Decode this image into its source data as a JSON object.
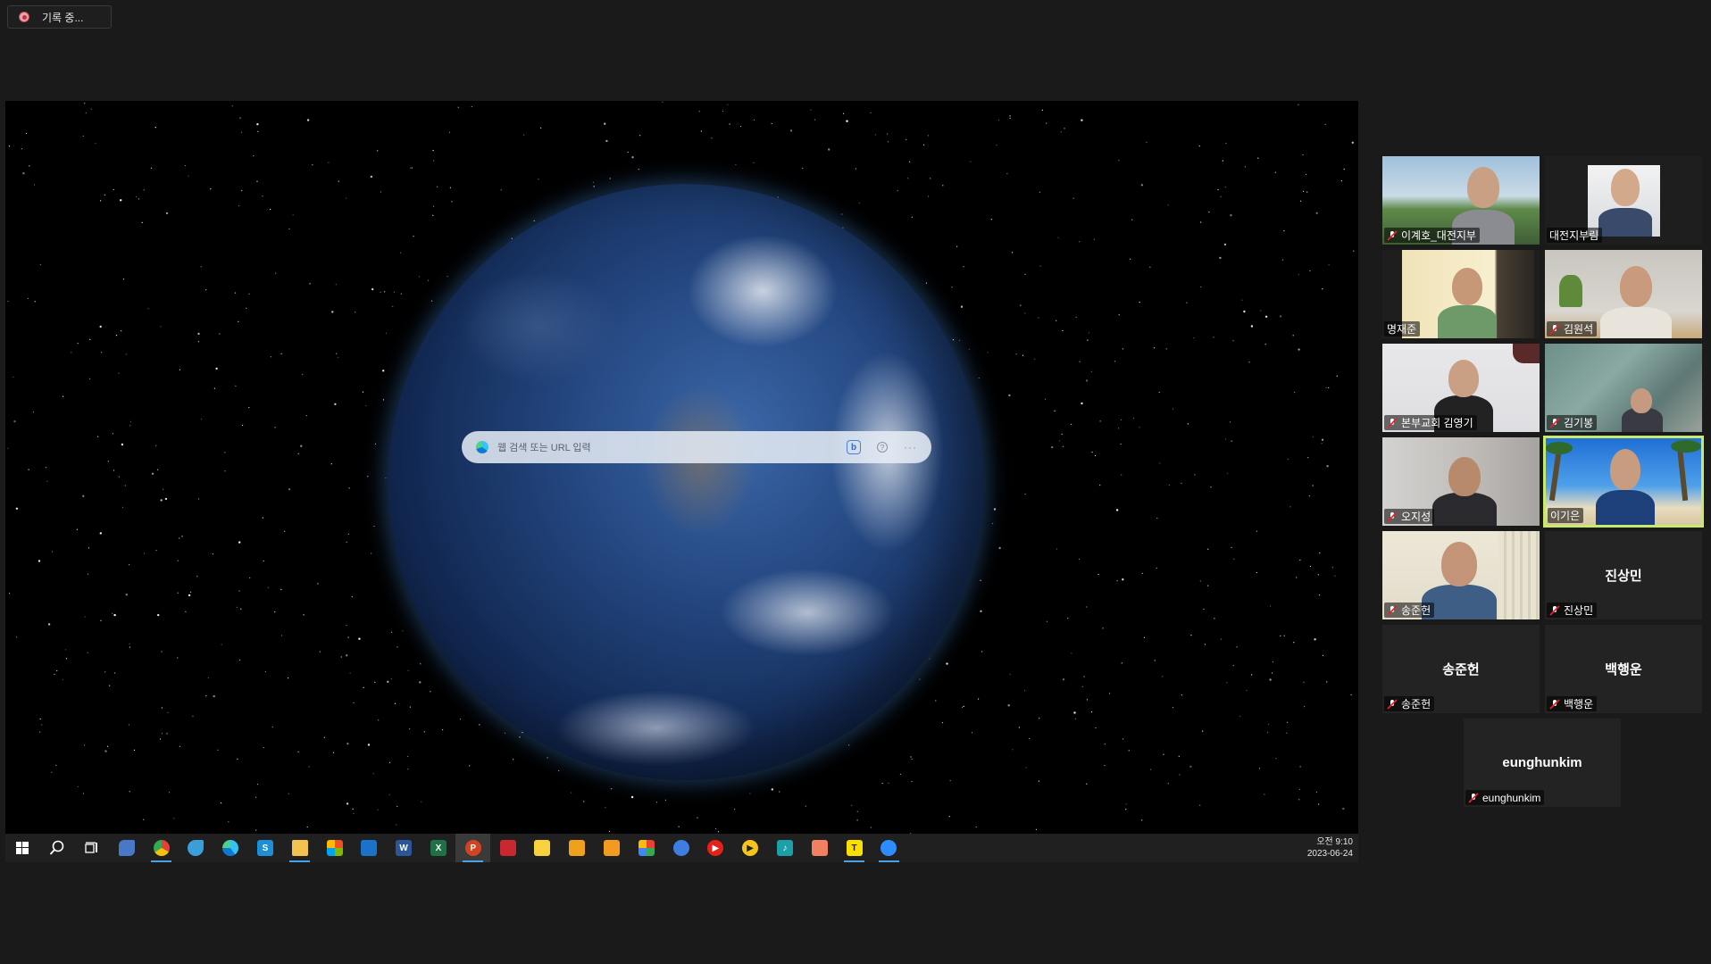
{
  "recording": {
    "label": "기록 중..."
  },
  "shared_screen": {
    "search_placeholder": "웹 검색 또는 URL 입력",
    "search_buttons": {
      "bing": "b",
      "more": "···"
    },
    "taskbar": {
      "icons": [
        "windows-start-icon",
        "search-icon",
        "task-view-icon",
        "onedrive-icon",
        "chrome-icon",
        "app-bird-icon",
        "edge-icon",
        "store-app-icon",
        "file-explorer-icon",
        "microsoft-store-icon",
        "mail-icon",
        "word-icon",
        "excel-icon",
        "powerpoint-icon",
        "app-red-icon",
        "sticky-notes-icon",
        "app-orange-1-icon",
        "app-orange-2-icon",
        "app-photos-icon",
        "app-blue-robot-icon",
        "youtube-icon",
        "kakao-media-icon",
        "tiktok-icon",
        "app-coral-icon",
        "kakaotalk-icon",
        "zoom-icon"
      ],
      "clock_time": "오전 9:10",
      "clock_date": "2023-06-24"
    }
  },
  "participants": [
    {
      "name": "이계호_대전지부",
      "has_video": true,
      "muted": true,
      "speaking": false
    },
    {
      "name": "대전지부림",
      "has_video": true,
      "muted": false,
      "speaking": false
    },
    {
      "name": "명재준",
      "has_video": true,
      "muted": false,
      "speaking": false
    },
    {
      "name": "김원석",
      "has_video": true,
      "muted": true,
      "speaking": false
    },
    {
      "name": "본부교회 김영기",
      "has_video": true,
      "muted": true,
      "speaking": false
    },
    {
      "name": "김기봉",
      "has_video": true,
      "muted": true,
      "speaking": false
    },
    {
      "name": "오지성",
      "has_video": true,
      "muted": true,
      "speaking": false
    },
    {
      "name": "이기은",
      "has_video": true,
      "muted": false,
      "speaking": true
    },
    {
      "name": "송준헌",
      "has_video": true,
      "muted": true,
      "speaking": false
    },
    {
      "name": "진상민",
      "has_video": false,
      "muted": true,
      "speaking": false
    },
    {
      "name": "송준헌",
      "has_video": false,
      "muted": true,
      "speaking": false
    },
    {
      "name": "백행운",
      "has_video": false,
      "muted": true,
      "speaking": false
    },
    {
      "name": "eunghunkim",
      "has_video": false,
      "muted": true,
      "speaking": false
    }
  ],
  "colors": {
    "background": "#1a1a1a",
    "speaking_border": "#c7e96d",
    "mute_red": "#e0242e"
  }
}
